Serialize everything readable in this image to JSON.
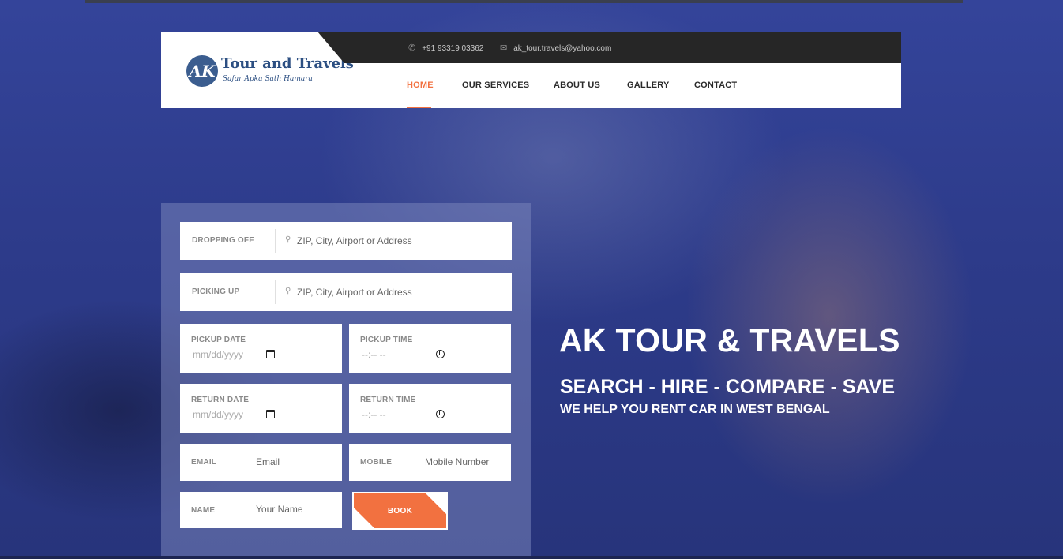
{
  "brand": {
    "logo_letters": "AK",
    "logo_title": "Tour and Travels",
    "logo_tagline": "Safar Apka Sath Hamara"
  },
  "contact": {
    "phone": "+91 93319 03362",
    "email": "ak_tour.travels@yahoo.com"
  },
  "nav": {
    "items": [
      "HOME",
      "OUR SERVICES",
      "ABOUT US",
      "GALLERY",
      "CONTACT"
    ],
    "active": "HOME"
  },
  "form": {
    "dropping_off": {
      "label": "DROPPING OFF",
      "placeholder": "ZIP, City, Airport or Address"
    },
    "picking_up": {
      "label": "PICKING UP",
      "placeholder": "ZIP, City, Airport or Address"
    },
    "pickup_date": {
      "label": "PICKUP DATE",
      "value": "mm/dd/yyyy"
    },
    "pickup_time": {
      "label": "PICKUP TIME",
      "value": "--:-- --"
    },
    "return_date": {
      "label": "RETURN DATE",
      "value": "mm/dd/yyyy"
    },
    "return_time": {
      "label": "RETURN TIME",
      "value": "--:-- --"
    },
    "email": {
      "label": "EMAIL",
      "placeholder": "Email"
    },
    "mobile": {
      "label": "MOBILE",
      "placeholder": "Mobile Number"
    },
    "name": {
      "label": "NAME",
      "placeholder": "Your Name"
    },
    "book_label": "BOOK"
  },
  "hero": {
    "title": "AK TOUR & TRAVELS",
    "subtitle": "SEARCH - HIRE - COMPARE - SAVE",
    "tagline": "WE HELP YOU RENT CAR IN WEST BENGAL"
  },
  "colors": {
    "accent": "#f27140",
    "topbar": "#262626",
    "hero_bg": "#2f3c86"
  }
}
